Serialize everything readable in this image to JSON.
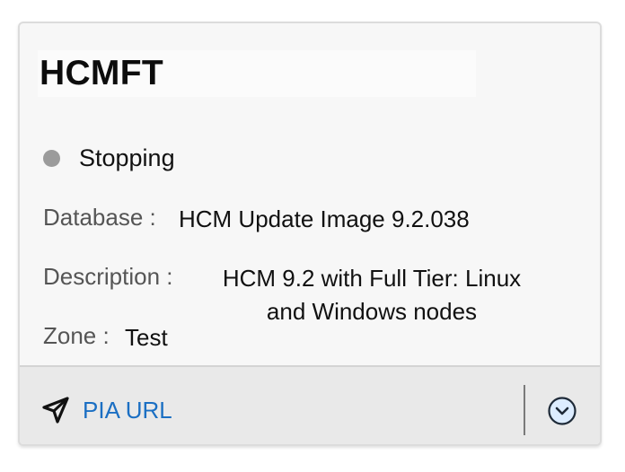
{
  "card": {
    "title": "HCMFT",
    "status": {
      "text": "Stopping",
      "dot_color": "#9b9b9b"
    },
    "fields": {
      "database_label": "Database :",
      "database_value": "HCM Update Image 9.2.038",
      "description_label": "Description :",
      "description_value_line1": "HCM 9.2 with Full Tier: Linux",
      "description_value_line2": "and Windows nodes",
      "zone_label": "Zone :",
      "zone_value": "Test"
    },
    "footer": {
      "link_label": "PIA URL",
      "link_icon": "navigation-arrow-icon",
      "menu_icon": "chevron-down-circle-icon"
    }
  },
  "colors": {
    "link": "#1b6fc3",
    "card_bg": "#f7f7f7",
    "footer_bg": "#e9e9e9"
  }
}
